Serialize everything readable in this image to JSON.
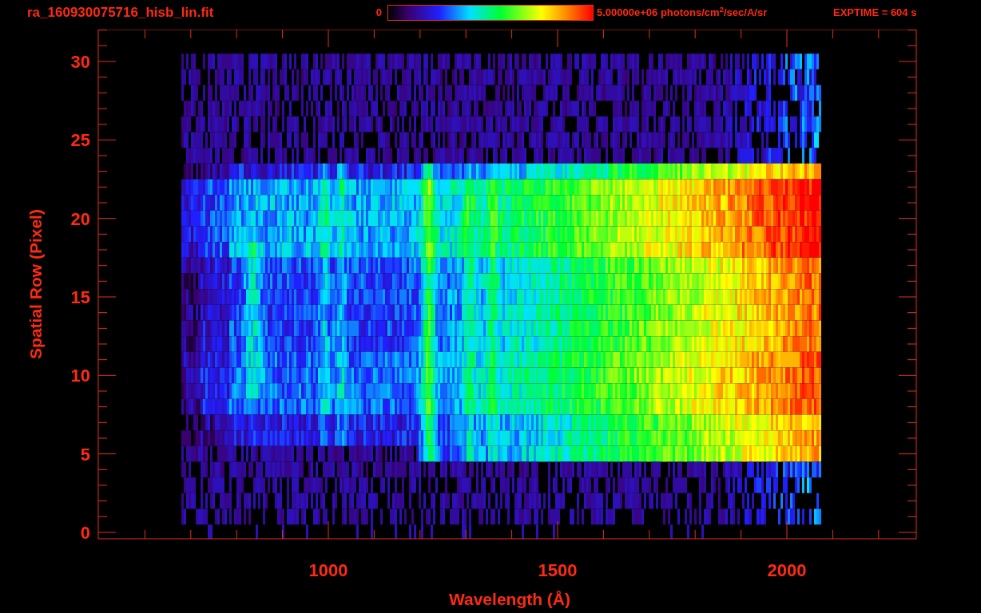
{
  "title": "ra_160930075716_hisb_lin.fit",
  "colorbar": {
    "min_label": "0",
    "max_label": "5.00000e+06 photons/cm$^{2}$/sec/A/sr"
  },
  "exposure": "EXPTIME = 604 s",
  "plot": {
    "xlabel": "Wavelength (Å)",
    "ylabel": "Spatial Row (Pixel)",
    "xticks": [
      "1000",
      "1500",
      "2000"
    ],
    "yticks": [
      "30",
      "25",
      "20",
      "15",
      "10",
      "5",
      "0"
    ]
  }
}
